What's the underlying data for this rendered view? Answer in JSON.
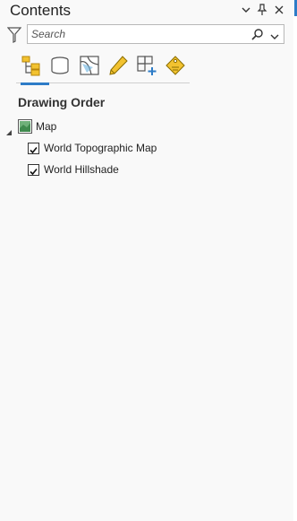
{
  "panel": {
    "title": "Contents"
  },
  "search": {
    "placeholder": "Search"
  },
  "toolbar": {
    "tools": [
      "list-by-drawing-order-icon",
      "list-by-source-icon",
      "list-by-selection-icon",
      "list-by-editing-icon",
      "list-by-snapping-icon",
      "list-by-labeling-icon"
    ],
    "accent_color": "#2d7cc7"
  },
  "section": {
    "title": "Drawing Order"
  },
  "tree": {
    "map": {
      "label": "Map"
    },
    "layers": [
      {
        "label": "World Topographic Map",
        "checked": true
      },
      {
        "label": "World Hillshade",
        "checked": true
      }
    ]
  }
}
